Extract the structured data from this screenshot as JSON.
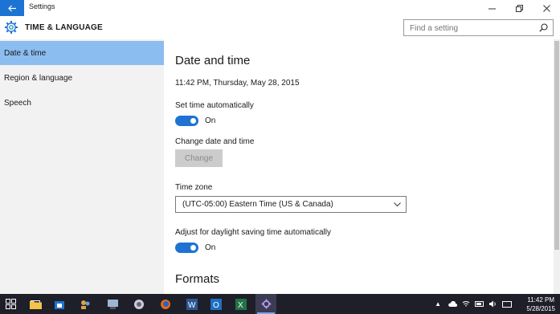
{
  "window": {
    "title": "Settings",
    "controls": {
      "minimize": "—",
      "maximize": "❐",
      "close": "✕"
    }
  },
  "header": {
    "section_title": "TIME & LANGUAGE",
    "search_placeholder": "Find a setting"
  },
  "sidebar": {
    "items": [
      {
        "label": "Date & time",
        "active": true
      },
      {
        "label": "Region & language",
        "active": false
      },
      {
        "label": "Speech",
        "active": false
      }
    ]
  },
  "main": {
    "title": "Date and time",
    "current_datetime": "11:42 PM, Thursday, May 28, 2015",
    "set_time_auto": {
      "label": "Set time automatically",
      "state": "On",
      "on": true
    },
    "change_datetime": {
      "label": "Change date and time",
      "button": "Change"
    },
    "time_zone": {
      "label": "Time zone",
      "value": "(UTC-05:00) Eastern Time (US & Canada)"
    },
    "daylight": {
      "label": "Adjust for daylight saving time automatically",
      "state": "On",
      "on": true
    },
    "formats_title": "Formats"
  },
  "taskbar": {
    "clock_time": "11:42 PM",
    "clock_date": "5/28/2015",
    "accent": "#1e73d2"
  }
}
